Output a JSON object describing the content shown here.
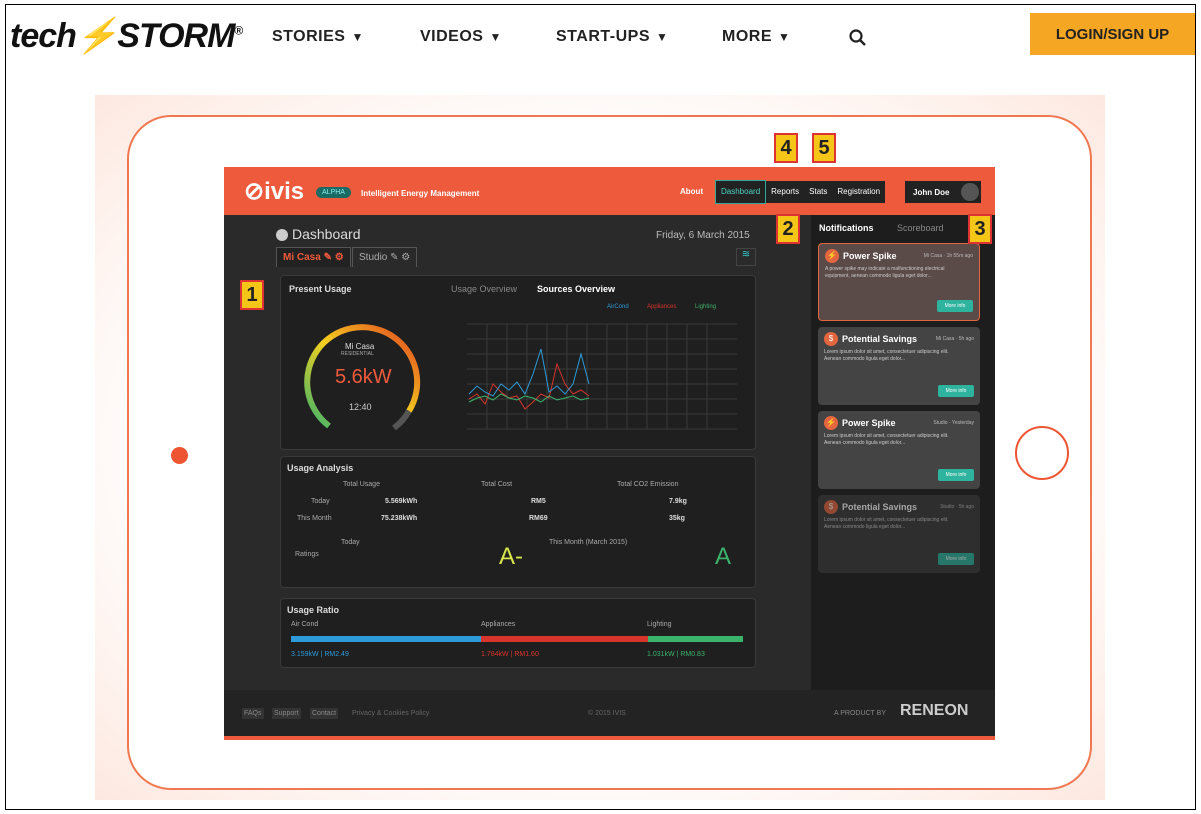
{
  "site": {
    "logo_text": "tech",
    "logo_bolt": "⚡",
    "logo_rest": "STORM",
    "logo_mark": "®",
    "nav": [
      {
        "label": "STORIES"
      },
      {
        "label": "VIDEOS"
      },
      {
        "label": "START-UPS"
      },
      {
        "label": "MORE"
      }
    ],
    "login_label": "LOGIN/SIGN UP",
    "accent": "#f5a623"
  },
  "app": {
    "logo": "⊘ivis",
    "badge": "ALPHA",
    "tagline": "Intelligent Energy Management",
    "nav_about": "About",
    "tabs": [
      "Dashboard",
      "Reports",
      "Stats",
      "Registration"
    ],
    "user": "John Doe",
    "accent": "#ee5a3c",
    "teal": "#2db39e"
  },
  "dashboard": {
    "title": "Dashboard",
    "date": "Friday, 6 March 2015",
    "locations": [
      "Mi Casa ✎ ⚙",
      "Studio ✎ ⚙"
    ],
    "present_usage": {
      "title": "Present Usage",
      "place": "Mi Casa",
      "place_type": "RESIDENTIAL",
      "value": "5.6kW",
      "time": "12:40"
    },
    "chart_tabs": [
      "Usage Overview",
      "Sources Overview"
    ],
    "legend": [
      "AirCond",
      "Appliances",
      "Lighting"
    ],
    "usage_analysis": {
      "title": "Usage Analysis",
      "headers": [
        "Total Usage",
        "Total Cost",
        "Total CO2 Emission"
      ],
      "rows": [
        {
          "label": "Today",
          "usage": "5.569kWh",
          "cost": "RM5",
          "co2": "7.9kg"
        },
        {
          "label": "This Month",
          "usage": "75.238kWh",
          "cost": "RM69",
          "co2": "35kg"
        }
      ]
    },
    "ratings": {
      "label": "Ratings",
      "today_label": "Today",
      "today_grade": "A-",
      "month_label": "This Month (March 2015)",
      "month_grade": "A"
    },
    "usage_ratio": {
      "title": "Usage Ratio",
      "items": [
        {
          "name": "Air Cond",
          "value": "3.159kW | RM2.49",
          "color": "#2e9ad9",
          "fraction": 0.42
        },
        {
          "name": "Appliances",
          "value": "1.784kW | RM1.60",
          "color": "#d9342b",
          "fraction": 0.37
        },
        {
          "name": "Lighting",
          "value": "1.031kW | RM0.83",
          "color": "#3bb36b",
          "fraction": 0.21
        }
      ]
    }
  },
  "notifications": {
    "tabs": [
      "Notifications",
      "Scoreboard"
    ],
    "items": [
      {
        "title": "Power Spike",
        "meta": "Mi Casa · 1h 55m ago",
        "text": "A power spike may indicate a malfunctioning electrical equipment, aenean commodo ligula eget dolor...",
        "button": "More info",
        "icon": "⚡"
      },
      {
        "title": "Potential Savings",
        "meta": "Mi Casa · 5h ago",
        "text": "Lorem ipsum dolor sit amet, consectetuer adipiscing elit. Aenean commodo ligula eget dolor...",
        "button": "More info",
        "icon": "$"
      },
      {
        "title": "Power Spike",
        "meta": "Studio · Yesterday",
        "text": "Lorem ipsum dolor sit amet, consectetuer adipiscing elit. Aenean commodo ligula eget dolor...",
        "button": "More info",
        "icon": "⚡"
      },
      {
        "title": "Potential Savings",
        "meta": "Studio · 5h ago",
        "text": "Lorem ipsum dolor sit amet, consectetuer adipiscing elit. Aenean commodo ligula eget dolor...",
        "button": "More info",
        "icon": "$"
      }
    ]
  },
  "footer": {
    "links": [
      "FAQs",
      "Support",
      "Contact"
    ],
    "policy": "Privacy & Cookies Policy",
    "copyright": "© 2015 IVIS",
    "product_by": "A PRODUCT BY",
    "company": "RENEON"
  },
  "callouts": [
    "1",
    "2",
    "3",
    "4",
    "5"
  ]
}
